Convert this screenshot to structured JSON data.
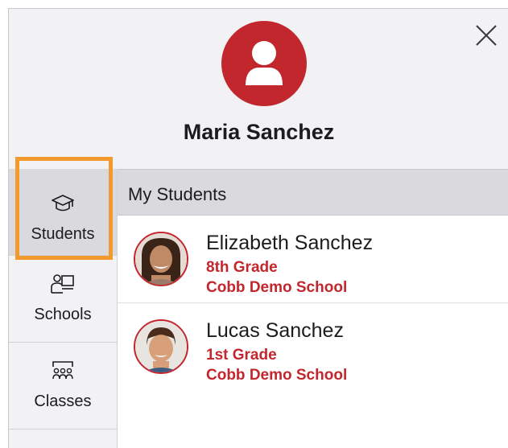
{
  "profile": {
    "name": "Maria Sanchez",
    "accent_color": "#c2272d"
  },
  "icons": {
    "avatar": "person-icon",
    "close": "close-icon"
  },
  "sidebar": {
    "items": [
      {
        "label": "Students",
        "icon": "graduation-cap-icon",
        "active": true
      },
      {
        "label": "Schools",
        "icon": "school-presenter-icon",
        "active": false
      },
      {
        "label": "Classes",
        "icon": "classroom-icon",
        "active": false
      }
    ],
    "highlight_color": "#f29a2e"
  },
  "main": {
    "section_title": "My Students",
    "students": [
      {
        "name": "Elizabeth Sanchez",
        "grade": "8th Grade",
        "school": "Cobb Demo School"
      },
      {
        "name": "Lucas Sanchez",
        "grade": "1st Grade",
        "school": "Cobb Demo School"
      }
    ]
  }
}
